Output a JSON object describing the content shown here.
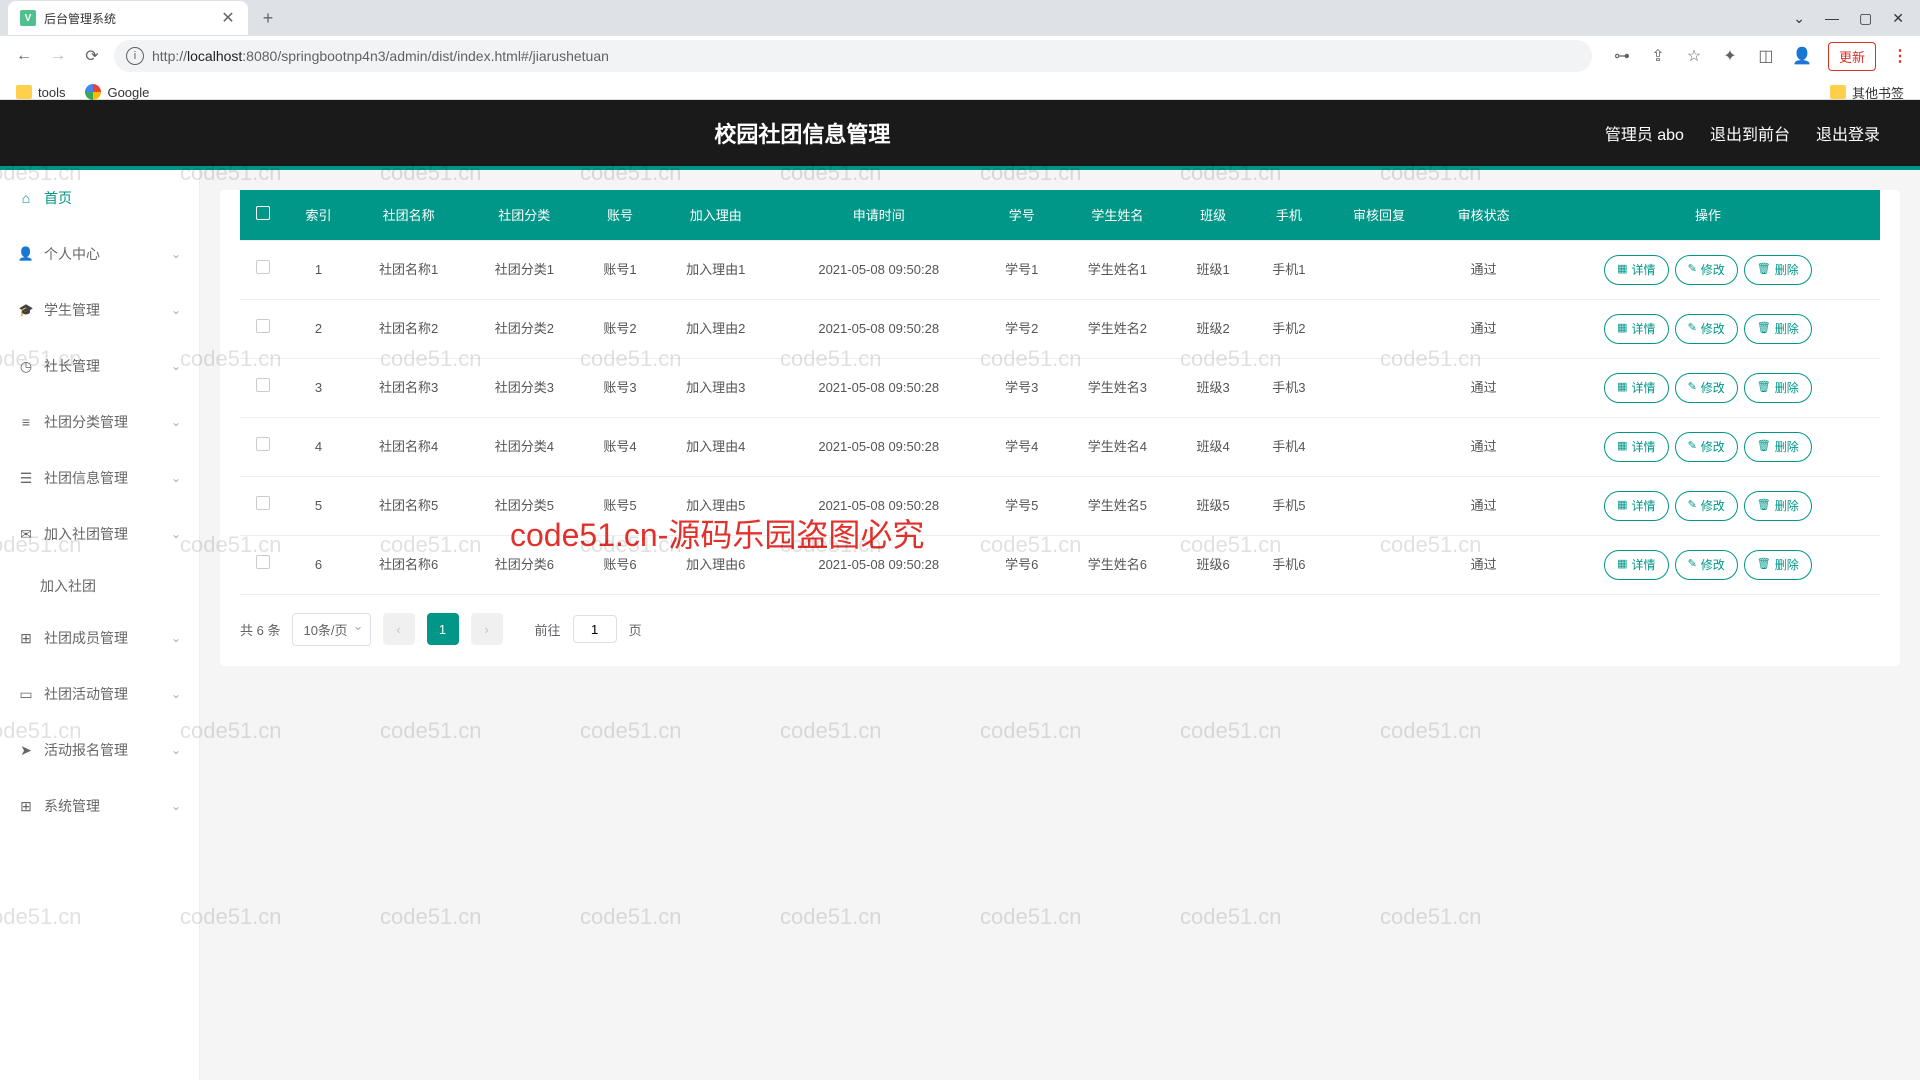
{
  "browser": {
    "tab_title": "后台管理系统",
    "url_host": "localhost",
    "url_port": ":8080",
    "url_path": "/springbootnp4n3/admin/dist/index.html#/jiarushetuan",
    "url_prefix": "http://",
    "update_btn": "更新",
    "bookmarks": {
      "tools": "tools",
      "google": "Google",
      "other": "其他书签"
    },
    "win_controls": {
      "dropdown": "⌄",
      "minimize": "—",
      "maximize": "▢",
      "close": "✕"
    }
  },
  "header": {
    "title": "校园社团信息管理",
    "user_label": "管理员 abo",
    "logout_front": "退出到前台",
    "logout": "退出登录"
  },
  "sidebar": {
    "items": [
      {
        "label": "首页",
        "active": true
      },
      {
        "label": "个人中心",
        "arrow": true
      },
      {
        "label": "学生管理",
        "arrow": true
      },
      {
        "label": "社长管理",
        "arrow": true
      },
      {
        "label": "社团分类管理",
        "arrow": true
      },
      {
        "label": "社团信息管理",
        "arrow": true
      },
      {
        "label": "加入社团管理",
        "arrow": true,
        "expanded": true,
        "sub": "加入社团"
      },
      {
        "label": "社团成员管理",
        "arrow": true
      },
      {
        "label": "社团活动管理",
        "arrow": true
      },
      {
        "label": "活动报名管理",
        "arrow": true
      },
      {
        "label": "系统管理",
        "arrow": true
      }
    ]
  },
  "table": {
    "headers": [
      "",
      "索引",
      "社团名称",
      "社团分类",
      "账号",
      "加入理由",
      "申请时间",
      "学号",
      "学生姓名",
      "班级",
      "手机",
      "审核回复",
      "审核状态",
      "操作"
    ],
    "rows": [
      {
        "idx": "1",
        "name": "社团名称1",
        "cat": "社团分类1",
        "acc": "账号1",
        "reason": "加入理由1",
        "time": "2021-05-08 09:50:28",
        "sno": "学号1",
        "sname": "学生姓名1",
        "cls": "班级1",
        "phone": "手机1",
        "reply": "",
        "status": "通过"
      },
      {
        "idx": "2",
        "name": "社团名称2",
        "cat": "社团分类2",
        "acc": "账号2",
        "reason": "加入理由2",
        "time": "2021-05-08 09:50:28",
        "sno": "学号2",
        "sname": "学生姓名2",
        "cls": "班级2",
        "phone": "手机2",
        "reply": "",
        "status": "通过"
      },
      {
        "idx": "3",
        "name": "社团名称3",
        "cat": "社团分类3",
        "acc": "账号3",
        "reason": "加入理由3",
        "time": "2021-05-08 09:50:28",
        "sno": "学号3",
        "sname": "学生姓名3",
        "cls": "班级3",
        "phone": "手机3",
        "reply": "",
        "status": "通过"
      },
      {
        "idx": "4",
        "name": "社团名称4",
        "cat": "社团分类4",
        "acc": "账号4",
        "reason": "加入理由4",
        "time": "2021-05-08 09:50:28",
        "sno": "学号4",
        "sname": "学生姓名4",
        "cls": "班级4",
        "phone": "手机4",
        "reply": "",
        "status": "通过"
      },
      {
        "idx": "5",
        "name": "社团名称5",
        "cat": "社团分类5",
        "acc": "账号5",
        "reason": "加入理由5",
        "time": "2021-05-08 09:50:28",
        "sno": "学号5",
        "sname": "学生姓名5",
        "cls": "班级5",
        "phone": "手机5",
        "reply": "",
        "status": "通过"
      },
      {
        "idx": "6",
        "name": "社团名称6",
        "cat": "社团分类6",
        "acc": "账号6",
        "reason": "加入理由6",
        "time": "2021-05-08 09:50:28",
        "sno": "学号6",
        "sname": "学生姓名6",
        "cls": "班级6",
        "phone": "手机6",
        "reply": "",
        "status": "通过"
      }
    ]
  },
  "actions": {
    "detail": "详情",
    "edit": "修改",
    "delete": "删除"
  },
  "pagination": {
    "total": "共 6 条",
    "page_size": "10条/页",
    "current": "1",
    "goto_prefix": "前往",
    "goto_suffix": "页",
    "goto_value": "1"
  },
  "watermark": {
    "text": "code51.cn",
    "main": "code51.cn-源码乐园盗图必究"
  }
}
